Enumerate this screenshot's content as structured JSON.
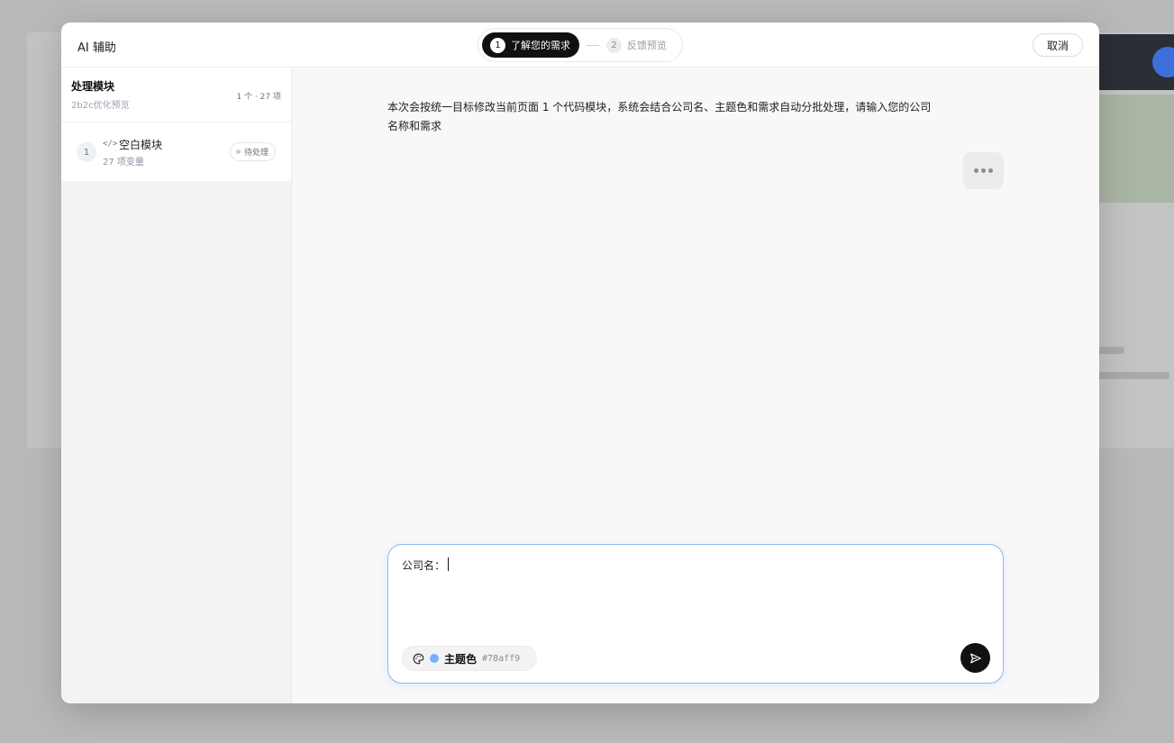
{
  "modal": {
    "title": "AI 辅助",
    "cancel_label": "取消"
  },
  "stepper": {
    "steps": [
      {
        "num": "1",
        "label": "了解您的需求",
        "active": true
      },
      {
        "num": "2",
        "label": "反馈预览",
        "active": false
      }
    ]
  },
  "sidebar": {
    "title": "处理模块",
    "subtitle": "2b2c优化预览",
    "count": "1 个 · 27 项",
    "items": [
      {
        "num": "1",
        "icon": "code-icon",
        "code_glyph": "</>",
        "title": "空白模块",
        "sub": "27 项变量",
        "status": "待处理"
      }
    ]
  },
  "chat": {
    "message": "本次会按统一目标修改当前页面 1 个代码模块，系统会结合公司名、主题色和需求自动分批处理，请输入您的公司名称和需求"
  },
  "composer": {
    "prefix": "公司名：",
    "theme_label": "主题色",
    "theme_hex": "#78aff9",
    "theme_color": "#78aff9"
  },
  "colors": {
    "accent": "#111111",
    "input_border": "#8fb5f5"
  }
}
